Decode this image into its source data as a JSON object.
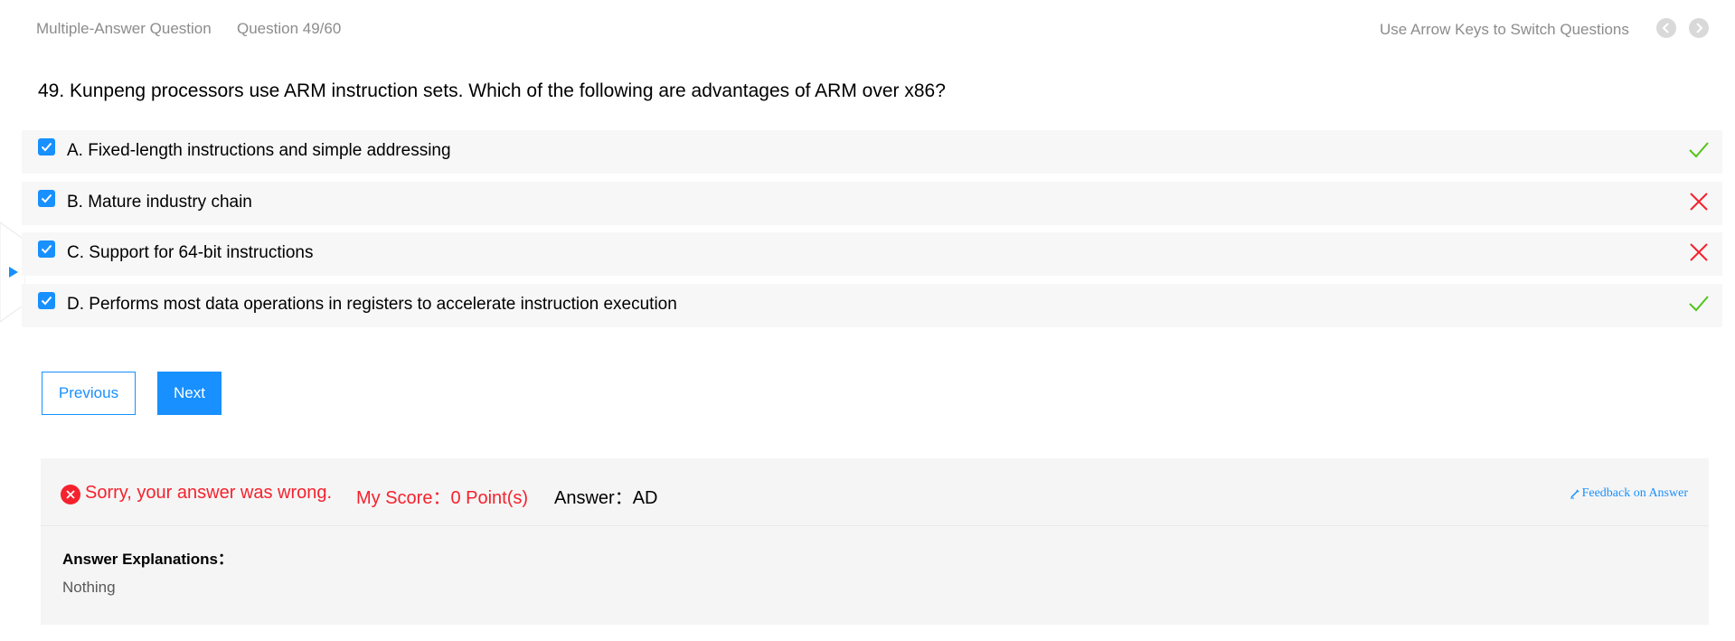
{
  "header": {
    "question_type": "Multiple-Answer Question",
    "question_counter": "Question 49/60",
    "keyboard_hint": "Use Arrow Keys to Switch Questions",
    "prev_icon": "chevron-left-icon",
    "next_icon": "chevron-right-icon"
  },
  "question": {
    "text": "49. Kunpeng processors use ARM instruction sets. Which of the following are advantages of ARM over x86?"
  },
  "options": [
    {
      "label": "A. Fixed-length instructions and simple addressing",
      "checked": true,
      "result": "correct"
    },
    {
      "label": "B. Mature industry chain",
      "checked": true,
      "result": "wrong"
    },
    {
      "label": "C. Support for 64-bit instructions",
      "checked": true,
      "result": "wrong"
    },
    {
      "label": "D. Performs most data operations in registers to accelerate instruction execution",
      "checked": true,
      "result": "correct"
    }
  ],
  "buttons": {
    "previous": "Previous",
    "next": "Next"
  },
  "result": {
    "status_text": "Sorry, your answer was wrong.",
    "score_text": "My Score：0 Point(s)",
    "answer_text": "Answer：AD",
    "feedback_link": "Feedback on Answer",
    "explanation_title": "Answer Explanations：",
    "explanation_body": "Nothing"
  },
  "colors": {
    "accent": "#1890ff",
    "error": "#f5222d",
    "success": "#52c41a",
    "muted_text": "#8c8c8c",
    "option_bg": "#f7f7f7",
    "panel_bg": "#f5f5f5"
  }
}
